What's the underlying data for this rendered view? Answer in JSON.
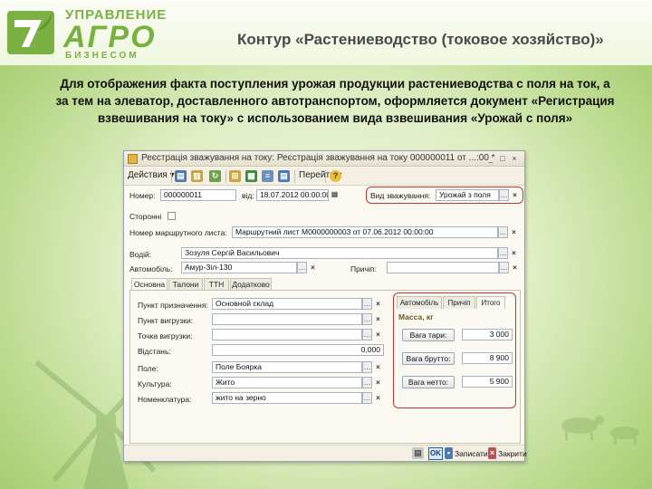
{
  "logo": {
    "line1": "УПРАВЛЕНИЕ",
    "main": "АГРО",
    "line2": "БИЗНЕСОМ"
  },
  "slide": {
    "title": "Контур «Растениеводство (токовое хозяйство)»",
    "description": "Для отображения факта поступления урожая продукции растениеводства с поля на ток, а за тем на элеватор,  доставленного автотранспортом, оформляется документ «Регистрация взвешивания на току» с использованием вида взвешивания «Урожай с поля»"
  },
  "window": {
    "title": "Реєстрація зважування на току: Реєстрація зважування на току 000000011 от ...:00 *",
    "controls": [
      "_",
      "□",
      "×"
    ],
    "toolbar": {
      "actions_label": "Действия ▾",
      "goto_label": "Перейти ▾",
      "help_label": "?"
    },
    "header": {
      "number_label": "Номер:",
      "number_value": "000000011",
      "date_label": "від:",
      "date_value": "18.07.2012 00:00:00",
      "weigh_type_label": "Вид зважування:",
      "weigh_type_value": "Урожай з поля",
      "third_party_label": "Сторонні",
      "route_label": "Номер маршрутного листа:",
      "route_value": "Маршрутний лист М0000000003 от 07.06.2012 00:00:00",
      "driver_label": "Водій:",
      "driver_value": "Зозуля Сергій Васильович",
      "car_label": "Автомобіль:",
      "car_value": "Амур-Зіл-130",
      "trailer_label": "Причіп:",
      "trailer_value": ""
    },
    "tabs": [
      "Основна",
      "Талони",
      "ТТН",
      "Додатково"
    ],
    "main_fields": [
      {
        "label": "Пункт призначення:",
        "value": "Основной склад"
      },
      {
        "label": "Пункт вигрузки:",
        "value": ""
      },
      {
        "label": "Точка вигрузки:",
        "value": ""
      },
      {
        "label": "Відстань:",
        "value": "0,000"
      },
      {
        "label": "Поле:",
        "value": "Поле Боярка"
      },
      {
        "label": "Культура:",
        "value": "Жито"
      },
      {
        "label": "Номенклатура:",
        "value": "жито на зерно"
      }
    ],
    "right_tabs": [
      "Автомобіль",
      "Причіп",
      "Итого"
    ],
    "mass": {
      "group_title": "Масса, кг",
      "rows": [
        {
          "button": "Вага тари:",
          "value": "3 000"
        },
        {
          "button": "Вага брутто:",
          "value": "8 900"
        },
        {
          "button": "Вага нетто:",
          "value": "5 900"
        }
      ]
    },
    "footer": {
      "ok": "OK",
      "save": "Записати",
      "close": "Закрити"
    }
  },
  "colors": {
    "highlight_box": "#c7332f",
    "logo_green": "#7bb042"
  }
}
